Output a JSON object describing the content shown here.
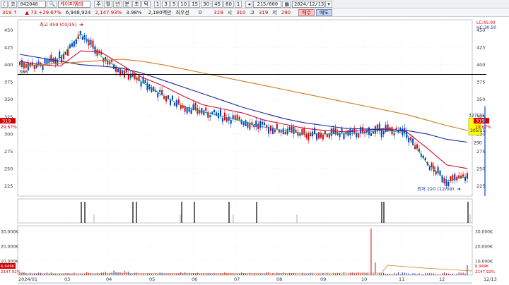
{
  "toolbar": {
    "code_prefix": "(",
    "market": "코",
    "code": "042040",
    "stock_name": "케이피엠테",
    "period_buttons": [
      "주",
      "월",
      "년",
      "분",
      "초",
      "틱"
    ],
    "interval_buttons": [
      "1",
      "3",
      "5",
      "10",
      "15",
      "30",
      "45",
      "60",
      "1"
    ],
    "counter": "215/600",
    "date": "2024/12/13"
  },
  "quote": {
    "price": "319",
    "change": "73",
    "change_pct": "+29.67%",
    "volume": "6,948,924",
    "volume_pct": "2,147.93%",
    "turnover_pct": "3.98%",
    "amount": "2,180백만",
    "best_bid_label": "최우선",
    "best_bid_value": "0",
    "last": "319",
    "open_label": "시",
    "open": "310",
    "high_label": "고",
    "high": "319",
    "low_label": "저",
    "low": "290",
    "buy_label": "매수",
    "sell_label": "매도"
  },
  "legend": {
    "lc": "LC:45.00",
    "hc": "HC:30.50"
  },
  "price_axis": {
    "ticks": [
      450,
      425,
      400,
      375,
      350,
      325,
      300,
      275,
      250,
      225
    ],
    "ymin": 210,
    "ymax": 465,
    "current_price": "319",
    "current_pct": "29.67%",
    "left_current": "319",
    "left_pct": "29.67%"
  },
  "reference_line": {
    "value": 386,
    "label": "386"
  },
  "annotations": {
    "high_label": "최고 459 (03/15)",
    "low_label": "최저 220 (12/09)",
    "box_label_top": "327(29.",
    "box_label_mid": "305(15.",
    "box_label_low": "290"
  },
  "volume_axis": {
    "ticks": [
      "30,000K",
      "20,000K",
      "10,000K"
    ],
    "current": "6,949K",
    "current_pct": "2147.92%"
  },
  "x_axis": {
    "labels": [
      "2024/01",
      "03",
      "04",
      "05",
      "06",
      "07",
      "08",
      "09",
      "10",
      "11",
      "12",
      "12/13"
    ]
  },
  "colors": {
    "up": "#e00000",
    "down": "#0040d0",
    "ma_short": "#00aa88",
    "ma_mid": "#c8102e",
    "ma_long": "#1a2a9c",
    "ma_longer": "#d07a20",
    "ref_line": "#000000",
    "highlight": "#ffff00"
  },
  "chart_data": {
    "type": "line",
    "title": "",
    "xlabel": "",
    "ylabel": "",
    "ylim": [
      210,
      465
    ],
    "x": [
      "2024/01",
      "03",
      "04",
      "05",
      "06",
      "07",
      "08",
      "09",
      "10",
      "11",
      "12",
      "12/13"
    ],
    "series": [
      {
        "values": [
          402,
          398,
          410,
          445,
          412,
          392,
          375,
          356,
          340,
          332,
          325,
          318,
          310,
          305,
          300,
          300,
          300,
          302,
          306,
          300,
          258,
          232,
          238
        ]
      },
      {
        "values": [
          405,
          400,
          398,
          420,
          418,
          400,
          382,
          370,
          355,
          342,
          336,
          330,
          320,
          314,
          308,
          305,
          303,
          305,
          308,
          303,
          280,
          255,
          250
        ]
      },
      {
        "values": [
          415,
          410,
          405,
          400,
          398,
          395,
          388,
          378,
          368,
          358,
          348,
          338,
          330,
          322,
          316,
          312,
          308,
          307,
          306,
          305,
          300,
          292,
          288
        ]
      },
      {
        "values": [
          398,
          400,
          402,
          404,
          406,
          408,
          405,
          400,
          394,
          388,
          382,
          376,
          370,
          364,
          358,
          352,
          346,
          340,
          334,
          328,
          320,
          312,
          305
        ]
      }
    ],
    "volume_ticks": [
      "30,000K",
      "20,000K",
      "10,000K"
    ]
  }
}
